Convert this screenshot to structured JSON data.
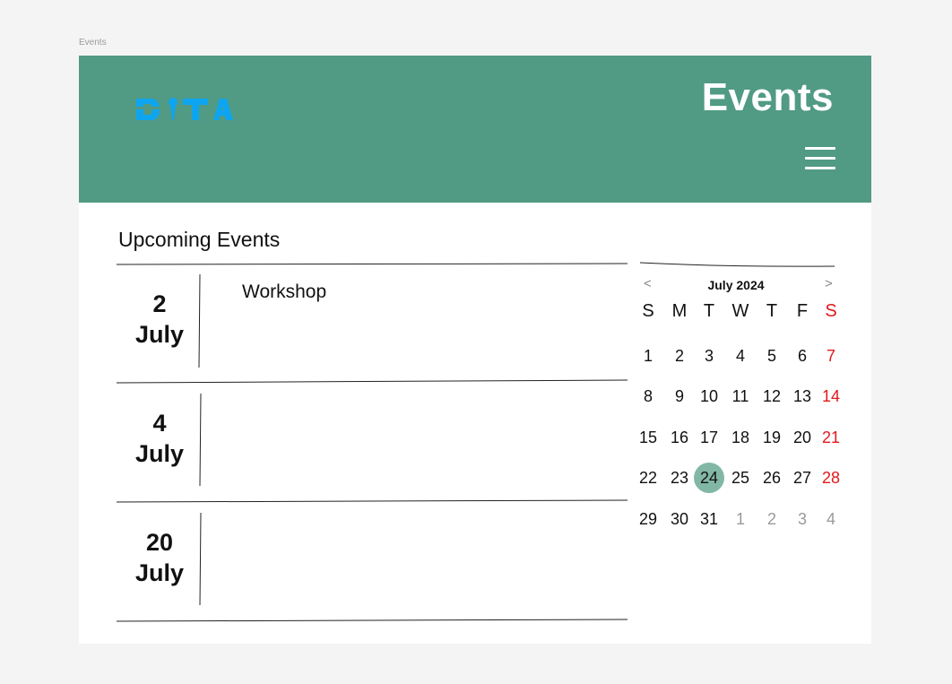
{
  "frame_label": "Events",
  "header": {
    "title": "Events",
    "logo_text": "DITA",
    "menu_icon": "hamburger-menu-icon",
    "bg_color": "#519a84"
  },
  "main": {
    "section_title": "Upcoming Events",
    "events": [
      {
        "day": "2",
        "month": "July",
        "title": "Workshop"
      },
      {
        "day": "4",
        "month": "July",
        "title": ""
      },
      {
        "day": "20",
        "month": "July",
        "title": ""
      }
    ]
  },
  "calendar": {
    "prev_icon": "chevron-left-icon",
    "next_icon": "chevron-right-icon",
    "prev": "<",
    "next": ">",
    "month_label": "July 2024",
    "weekdays": [
      "S",
      "M",
      "T",
      "W",
      "T",
      "F",
      "S"
    ],
    "weeks": [
      [
        "1",
        "2",
        "3",
        "4",
        "5",
        "6",
        "7"
      ],
      [
        "8",
        "9",
        "10",
        "11",
        "12",
        "13",
        "14"
      ],
      [
        "15",
        "16",
        "17",
        "18",
        "19",
        "20",
        "21"
      ],
      [
        "22",
        "23",
        "24",
        "25",
        "26",
        "27",
        "28"
      ],
      [
        "29",
        "30",
        "31",
        "1",
        "2",
        "3",
        "4"
      ]
    ],
    "selected_day": "24",
    "accent_color": "#82b7a5",
    "weekend_color": "#e0191c"
  }
}
